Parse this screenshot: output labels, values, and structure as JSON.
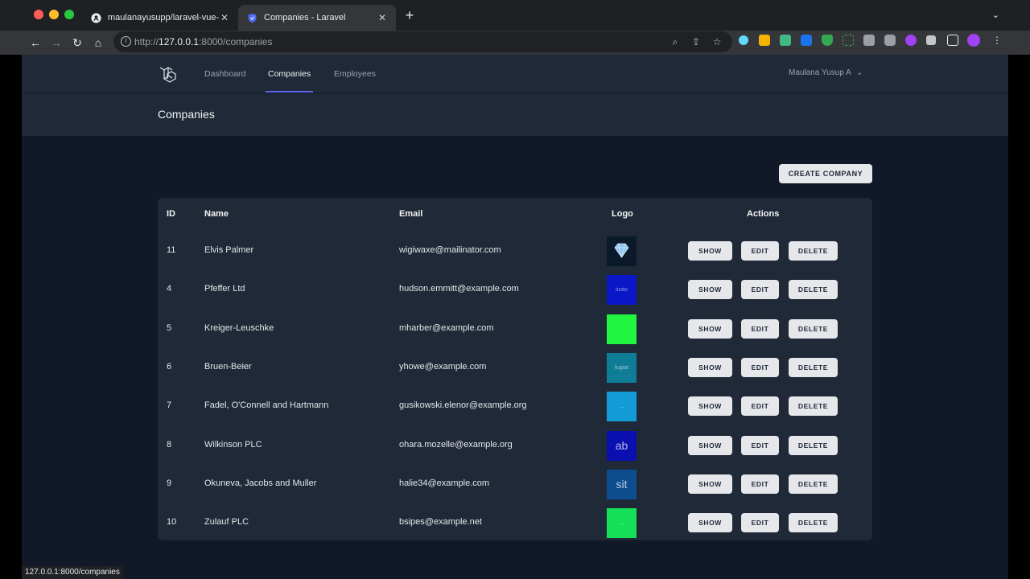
{
  "browser": {
    "tabs": [
      {
        "title": "maulanayusupp/laravel-vue-cr",
        "active": false,
        "favicon": "github-icon"
      },
      {
        "title": "Companies - Laravel",
        "active": true,
        "favicon": "shield-icon"
      }
    ],
    "url": {
      "scheme": "http://",
      "host": "127.0.0.1",
      "rest": ":8000/companies"
    },
    "status_url": "127.0.0.1:8000/companies"
  },
  "nav": {
    "links": [
      "Dashboard",
      "Companies",
      "Employees"
    ],
    "active": "Companies",
    "user": "Maulana Yusup A"
  },
  "page": {
    "title": "Companies",
    "create_button": "CREATE COMPANY"
  },
  "table": {
    "headers": {
      "id": "ID",
      "name": "Name",
      "email": "Email",
      "logo": "Logo",
      "actions": "Actions"
    },
    "actions": {
      "show": "SHOW",
      "edit": "EDIT",
      "delete": "DELETE"
    },
    "rows": [
      {
        "id": "11",
        "name": "Elvis Palmer",
        "email": "wigiwaxe@mailinator.com",
        "logo_color": "#0b1a2a",
        "logo_text": ""
      },
      {
        "id": "4",
        "name": "Pfeffer Ltd",
        "email": "hudson.emmitt@example.com",
        "logo_color": "#0a17c9",
        "logo_text": "iusto"
      },
      {
        "id": "5",
        "name": "Kreiger-Leuschke",
        "email": "mharber@example.com",
        "logo_color": "#22f53f",
        "logo_text": ""
      },
      {
        "id": "6",
        "name": "Bruen-Beier",
        "email": "yhowe@example.com",
        "logo_color": "#0f7d96",
        "logo_text": "fugiat"
      },
      {
        "id": "7",
        "name": "Fadel, O'Connell and Hartmann",
        "email": "gusikowski.elenor@example.org",
        "logo_color": "#139bd6",
        "logo_text": "..."
      },
      {
        "id": "8",
        "name": "Wilkinson PLC",
        "email": "ohara.mozelle@example.org",
        "logo_color": "#0a10b0",
        "logo_text": "ab"
      },
      {
        "id": "9",
        "name": "Okuneva, Jacobs and Muller",
        "email": "halie34@example.com",
        "logo_color": "#0d4d8f",
        "logo_text": "sit"
      },
      {
        "id": "10",
        "name": "Zulauf PLC",
        "email": "bsipes@example.net",
        "logo_color": "#16e05a",
        "logo_text": "..."
      }
    ]
  }
}
